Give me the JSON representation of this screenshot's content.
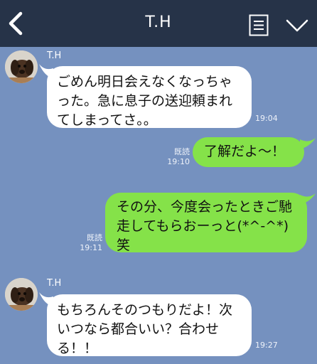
{
  "header": {
    "title": "T.H"
  },
  "messages": [
    {
      "sender": "T.H",
      "text": "ごめん明日会えなくなっちゃった。急に息子の送迎頼まれてしまってさ。。",
      "time": "19:04"
    },
    {
      "text": "了解だよ〜！",
      "read": "既読",
      "time": "19:10"
    },
    {
      "text": "その分、今度会ったときご馳走してもらおーっと(*^-^*)笑",
      "read": "既読",
      "time": "19:11"
    },
    {
      "sender": "T.H",
      "text": "もちろんそのつもりだよ！次いつなら都合いい？合わせる！！",
      "time": "19:27"
    }
  ],
  "colors": {
    "background": "#7591bf",
    "header": "#263348",
    "incoming_bubble": "#ffffff",
    "outgoing_bubble": "#85e249"
  },
  "icons": [
    "back-arrow-icon",
    "note-list-icon",
    "chevron-down-icon"
  ]
}
